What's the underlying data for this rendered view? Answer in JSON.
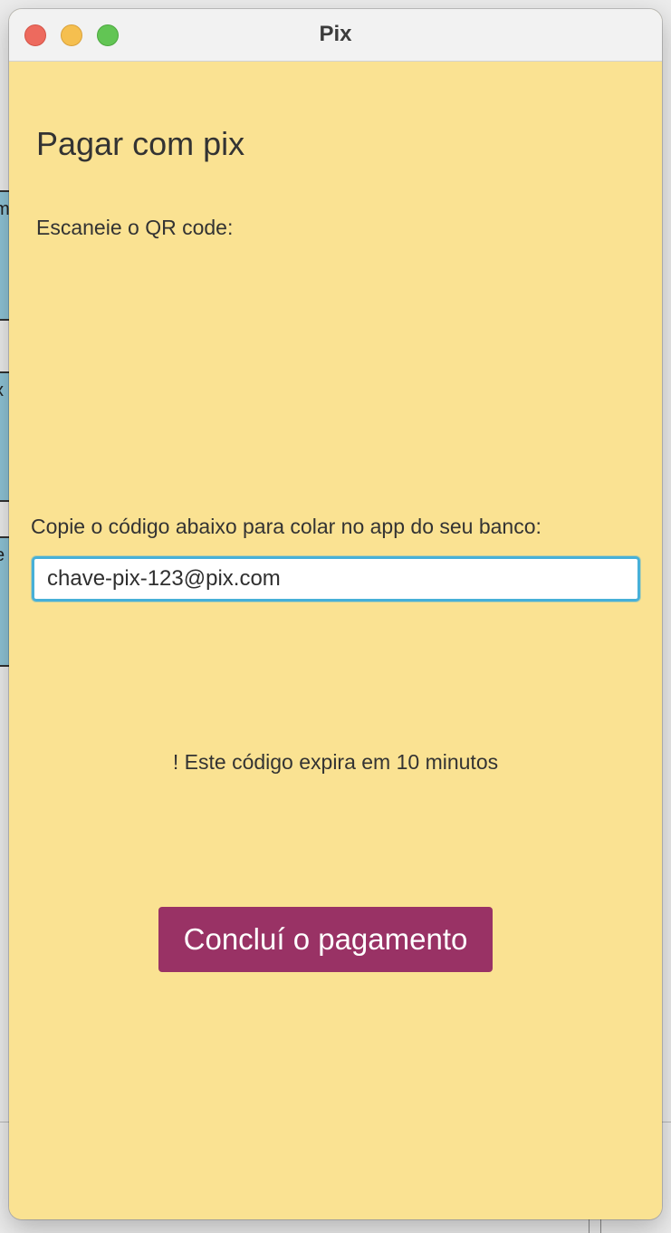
{
  "window": {
    "title": "Pix"
  },
  "page": {
    "heading": "Pagar com pix",
    "qr_label": "Escaneie o QR code:",
    "copy_label": "Copie o código abaixo para colar no app do seu banco:",
    "pix_key_value": "chave-pix-123@pix.com",
    "expire_note": "! Este código expira em 10 minutos",
    "confirm_button_label": "Concluí o pagamento"
  },
  "colors": {
    "background": "#fae292",
    "button": "#993265",
    "input_focus_border": "#47b0d8",
    "close": "#ed6a5e",
    "minimize": "#f5bf4f",
    "zoom": "#62c554"
  }
}
